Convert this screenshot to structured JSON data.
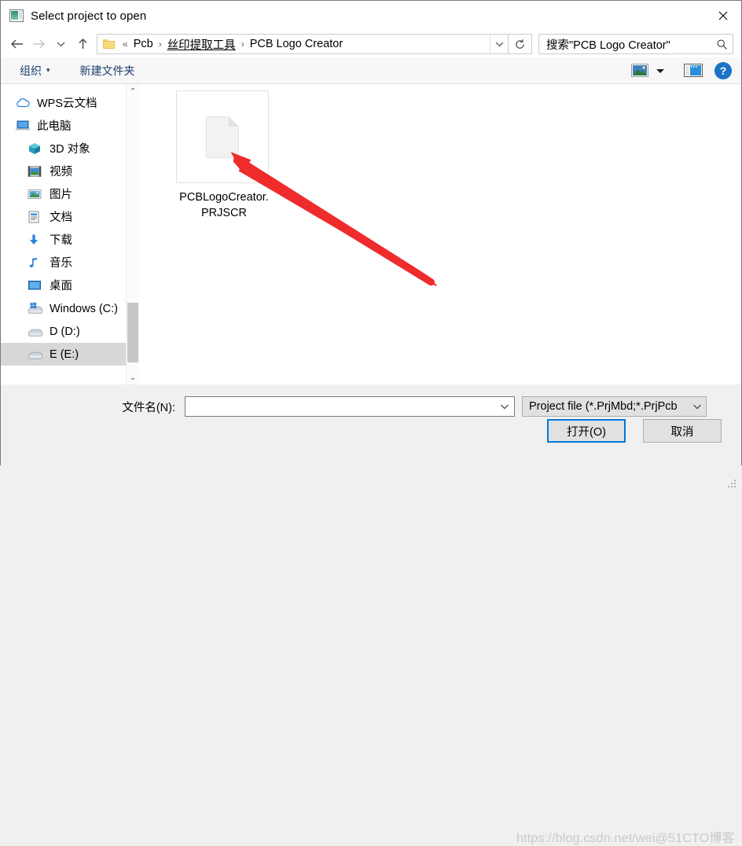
{
  "window": {
    "title": "Select project to open",
    "close_label": "✕"
  },
  "nav": {
    "back": "←",
    "forward": "→",
    "recent": "⌄",
    "up": "↑",
    "refresh": "↻"
  },
  "address": {
    "chevrons": "«",
    "crumbs": [
      {
        "label": "Pcb",
        "link": false
      },
      {
        "label": "丝印提取工具",
        "link": true
      },
      {
        "label": "PCB Logo Creator",
        "link": false
      }
    ],
    "separator": "›",
    "dropdown": "⌄"
  },
  "search": {
    "value": "搜索\"PCB Logo Creator\"",
    "icon": "search-icon"
  },
  "toolbar": {
    "organize_label": "组织",
    "organize_caret": "▾",
    "new_folder_label": "新建文件夹",
    "view_caret": "▾",
    "help_label": "?"
  },
  "sidebar": {
    "items": [
      {
        "label": "WPS云文档",
        "icon": "cloud-icon",
        "indent": false,
        "selected": false
      },
      {
        "label": "此电脑",
        "icon": "this-pc-icon",
        "indent": false,
        "selected": false
      },
      {
        "label": "3D 对象",
        "icon": "3d-objects-icon",
        "indent": true,
        "selected": false
      },
      {
        "label": "视频",
        "icon": "videos-icon",
        "indent": true,
        "selected": false
      },
      {
        "label": "图片",
        "icon": "pictures-icon",
        "indent": true,
        "selected": false
      },
      {
        "label": "文档",
        "icon": "documents-icon",
        "indent": true,
        "selected": false
      },
      {
        "label": "下载",
        "icon": "downloads-icon",
        "indent": true,
        "selected": false
      },
      {
        "label": "音乐",
        "icon": "music-icon",
        "indent": true,
        "selected": false
      },
      {
        "label": "桌面",
        "icon": "desktop-icon",
        "indent": true,
        "selected": false
      },
      {
        "label": "Windows (C:)",
        "icon": "windows-drive-icon",
        "indent": true,
        "selected": false
      },
      {
        "label": "D (D:)",
        "icon": "drive-icon",
        "indent": true,
        "selected": false
      },
      {
        "label": "E (E:)",
        "icon": "drive-icon",
        "indent": true,
        "selected": true
      }
    ],
    "scroll_up": "⌃",
    "scroll_down": "⌄"
  },
  "files": [
    {
      "name": "PCBLogoCreator.PRJSCR",
      "icon": "generic-file-icon"
    }
  ],
  "bottom": {
    "filename_label": "文件名(N):",
    "filename_value": "",
    "filename_placeholder": "",
    "filetype_value": "Project file (*.PrjMbd;*.PrjPcb",
    "filetype_caret": "⌄",
    "open_label": "打开(O)",
    "cancel_label": "取消"
  },
  "watermark": {
    "text": "https://blog.csdn.net/wei@51CTO博客"
  },
  "annotation": {
    "arrow_color": "#ef2b2b"
  },
  "colors": {
    "accent": "#0078d7",
    "help_blue": "#1a73c4",
    "selection": "#d8d8d8"
  }
}
